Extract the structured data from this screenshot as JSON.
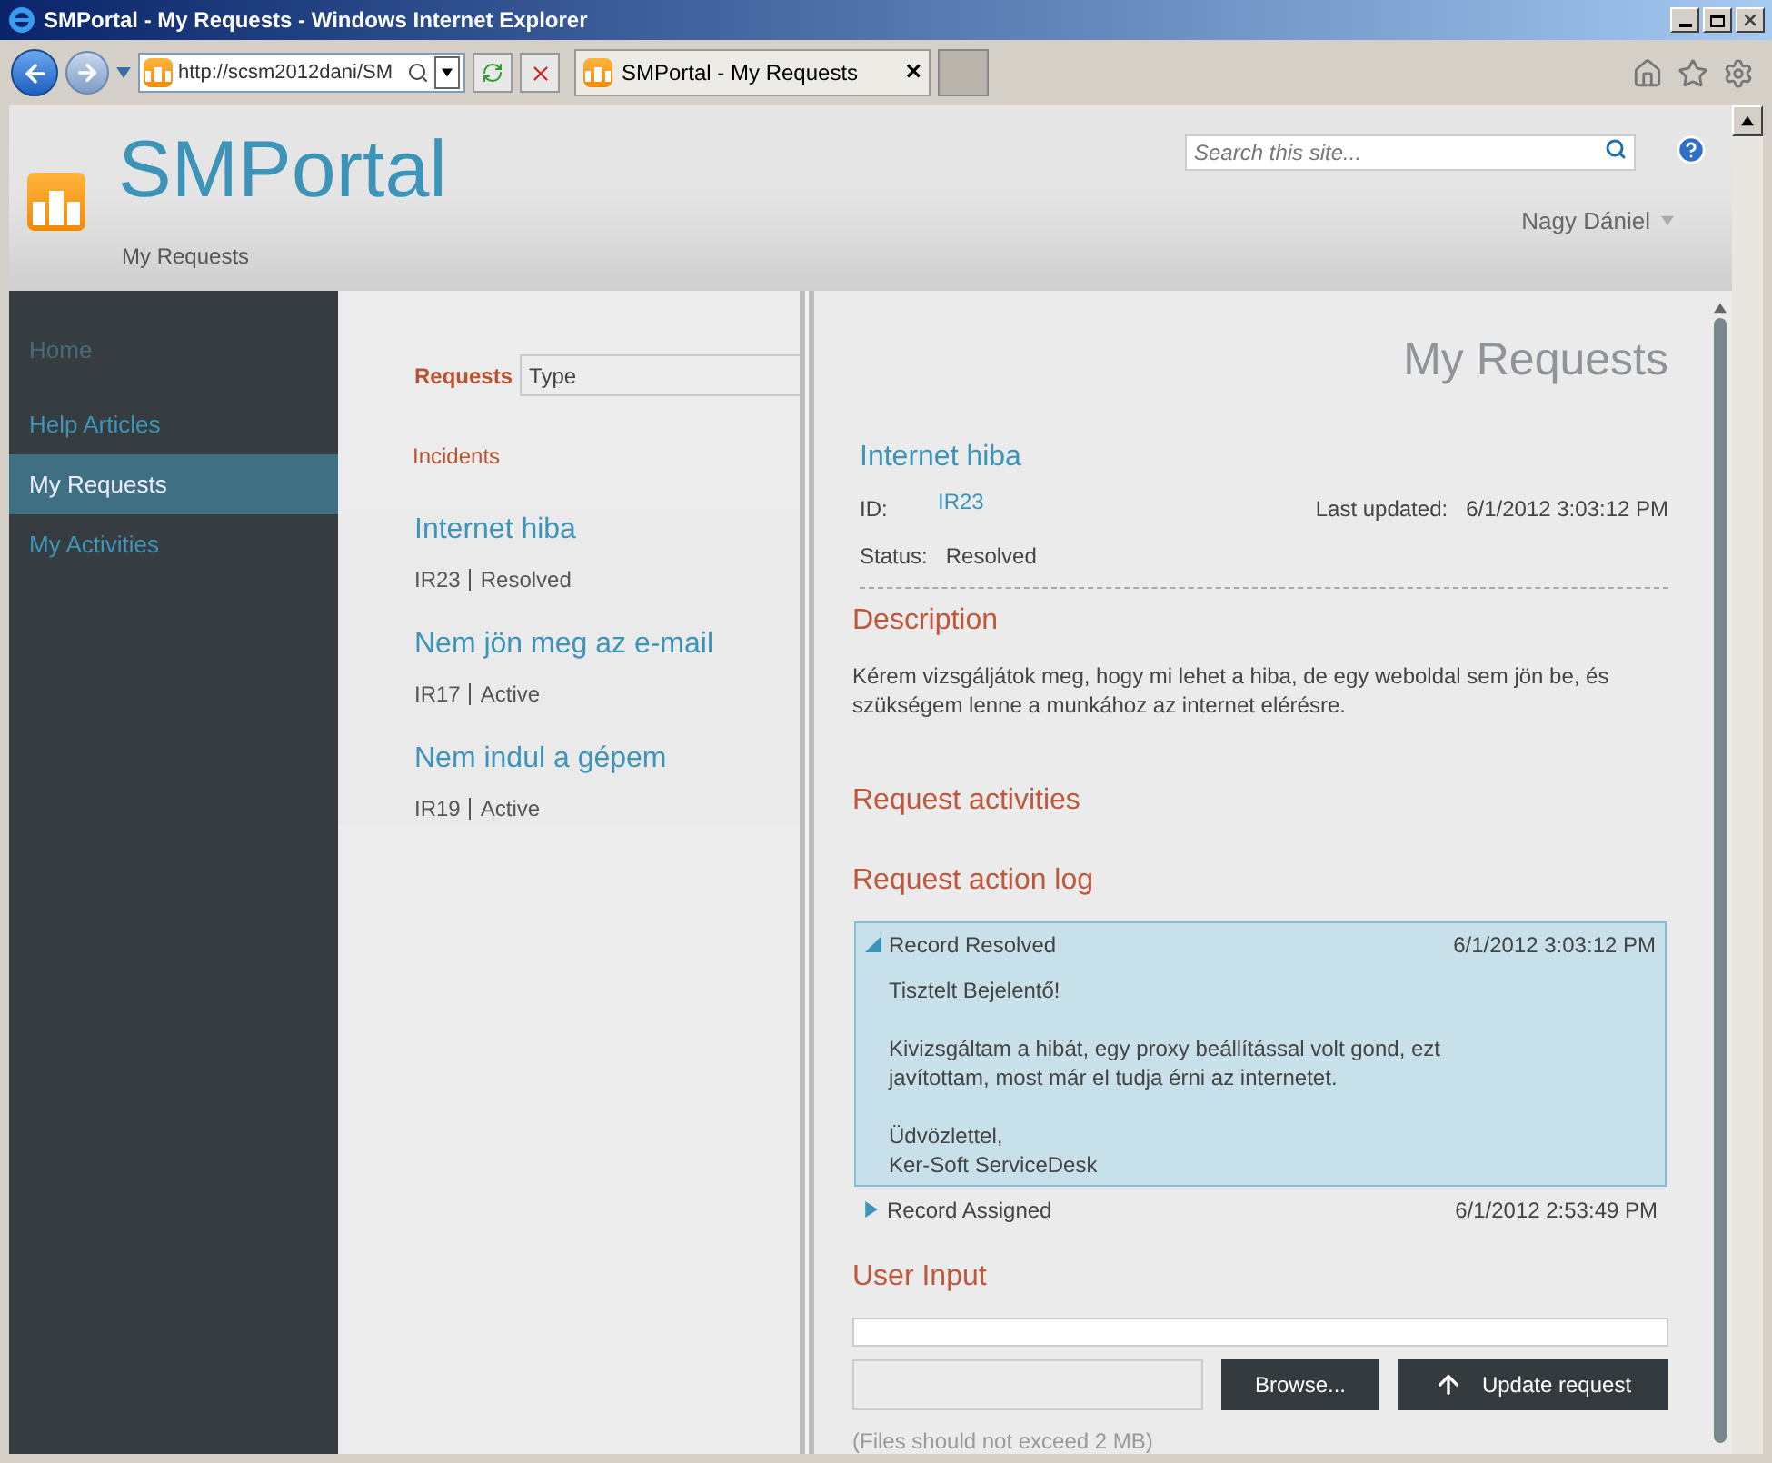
{
  "window": {
    "title": "SMPortal - My Requests - Windows Internet Explorer"
  },
  "browser": {
    "address": "http://scsm2012dani/SM",
    "tab": {
      "label": "SMPortal - My Requests",
      "close": "×"
    }
  },
  "header": {
    "site_title": "SMPortal",
    "breadcrumb": "My Requests",
    "search": {
      "placeholder": "Search this site..."
    },
    "user": "Nagy Dániel"
  },
  "sidebar": {
    "items": [
      {
        "label": "Home",
        "selected": false,
        "disabled": true
      },
      {
        "label": "Help Articles",
        "selected": false,
        "disabled": false
      },
      {
        "label": "My Requests",
        "selected": true,
        "disabled": false
      },
      {
        "label": "My Activities",
        "selected": false,
        "disabled": false
      }
    ]
  },
  "filter": {
    "label": "Requests",
    "type_field": {
      "value": "Type"
    },
    "categories": [
      "Incidents"
    ]
  },
  "requests": [
    {
      "title": "Internet hiba",
      "id": "IR23",
      "status": "Resolved"
    },
    {
      "title": "Nem jön meg az e-mail",
      "id": "IR17",
      "status": "Active"
    },
    {
      "title": "Nem indul a gépem",
      "id": "IR19",
      "status": "Active"
    }
  ],
  "detail": {
    "heading": "My Requests",
    "title": "Internet hiba",
    "id_label": "ID:",
    "id": "IR23",
    "last_updated_label": "Last updated:",
    "last_updated": "6/1/2012 3:03:12 PM",
    "status_label": "Status:",
    "status": "Resolved",
    "description_heading": "Description",
    "description": "Kérem vizsgáljátok meg, hogy mi lehet a hiba, de egy weboldal sem jön be, és szükségem lenne a munkához az internet elérésre.",
    "activities_heading": "Request activities",
    "log_heading": "Request action log",
    "log": [
      {
        "title": "Record Resolved",
        "time": "6/1/2012 3:03:12 PM",
        "expanded": true,
        "body": [
          "Tisztelt Bejelentő!",
          "Kivizsgáltam a hibát, egy proxy beállítással volt gond, ezt\njavítottam, most már el tudja érni az internetet.",
          "Üdvözlettel,\nKer-Soft ServiceDesk"
        ]
      },
      {
        "title": "Record Assigned",
        "time": "6/1/2012 2:53:49 PM",
        "expanded": false
      }
    ],
    "user_input_heading": "User Input",
    "browse_button": "Browse...",
    "update_button": "Update request",
    "file_note": "(Files should not exceed 2 MB)"
  }
}
